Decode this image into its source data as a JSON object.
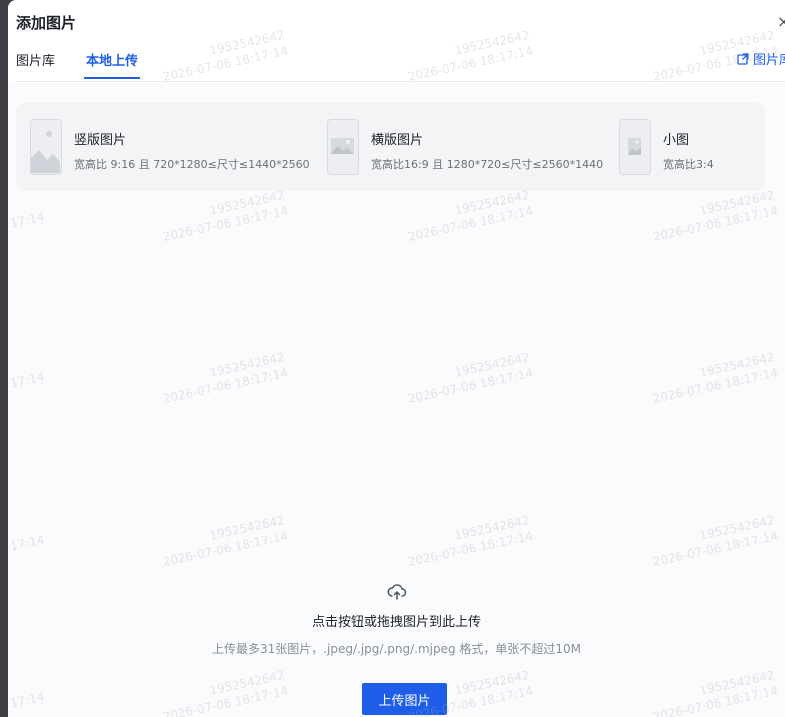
{
  "dialog": {
    "title": "添加图片",
    "close": "×"
  },
  "tabs": [
    {
      "label": "图片库",
      "active": false
    },
    {
      "label": "本地上传",
      "active": true
    }
  ],
  "library_link": {
    "label": "图片库",
    "icon": "external-link-icon"
  },
  "specs": [
    {
      "name": "竖版图片",
      "desc": "宽高比 9:16 且 720*1280≤尺寸≤1440*2560",
      "icon": "portrait-image-icon"
    },
    {
      "name": "横版图片",
      "desc": "宽高比16:9 且 1280*720≤尺寸≤2560*1440",
      "icon": "landscape-image-icon"
    },
    {
      "name": "小图",
      "desc": "宽高比3:4",
      "icon": "small-image-icon"
    }
  ],
  "upload": {
    "icon": "cloud-upload-icon",
    "main_text": "点击按钮或拖拽图片到此上传",
    "hint": "上传最多31张图片，.jpeg/.jpg/.png/.mjpeg 格式，单张不超过10M",
    "button_label": "上传图片"
  },
  "watermark": {
    "line1": "1952542642",
    "line2": "2026-07-06 18:17:14",
    "partial": "17:14"
  },
  "colors": {
    "accent": "#1e5de8",
    "text": "#1d2129",
    "muted": "#8a8f99",
    "panel": "#f3f4f6"
  }
}
